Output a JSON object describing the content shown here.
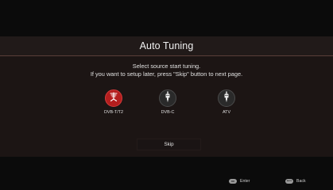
{
  "header": {
    "title": "Auto Tuning"
  },
  "instructions": {
    "line1": "Select source start tuning.",
    "line2": "If you want to setup later, press \"Skip\" button to next page."
  },
  "sources": [
    {
      "label": "DVB-T/T2",
      "icon": "antenna-icon",
      "selected": true
    },
    {
      "label": "DVB-C",
      "icon": "cable-plug-icon",
      "selected": false
    },
    {
      "label": "ATV",
      "icon": "cable-plug-icon",
      "selected": false
    }
  ],
  "skip": {
    "label": "Skip"
  },
  "footer": {
    "enter": {
      "key": "OK",
      "label": "Enter"
    },
    "back": {
      "key": "BACK",
      "label": "Back"
    }
  },
  "colors": {
    "selected_accent": "#b41e1e",
    "panel": "#1c1514",
    "title_bar": "#211a19"
  }
}
